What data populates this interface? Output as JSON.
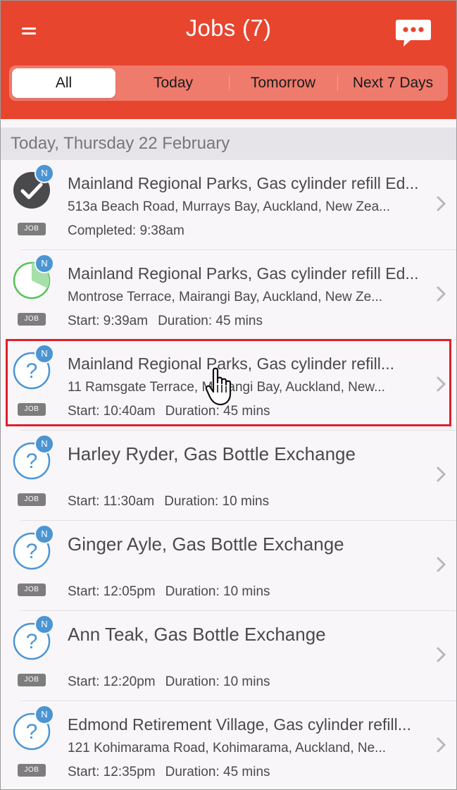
{
  "header": {
    "title": "Jobs (7)",
    "menu_icon": "hamburger-menu-icon",
    "chat_icon": "chat-bubble-icon",
    "background_color": "#e8452f"
  },
  "tabs": [
    {
      "label": "All",
      "active": true
    },
    {
      "label": "Today",
      "active": false
    },
    {
      "label": "Tomorrow",
      "active": false
    },
    {
      "label": "Next 7 Days",
      "active": false
    }
  ],
  "section": {
    "title": "Today, Thursday 22 February"
  },
  "jobs": [
    {
      "title": "Mainland Regional Parks, Gas cylinder refill Ed...",
      "address": "513a Beach Road, Murrays Bay, Auckland, New Zea...",
      "detail": "Completed: 9:38am",
      "duration": "",
      "status": "completed",
      "badge": "N",
      "tag": "JOB"
    },
    {
      "title": "Mainland Regional Parks, Gas cylinder refill Ed...",
      "address": "Montrose Terrace, Mairangi Bay, Auckland, New Ze...",
      "detail": "Start: 9:39am",
      "duration": "Duration: 45 mins",
      "status": "in-progress",
      "badge": "N",
      "tag": "JOB"
    },
    {
      "title": "Mainland Regional Parks, Gas cylinder refill...",
      "address": "11 Ramsgate Terrace, Mairangi Bay, Auckland, New...",
      "detail": "Start: 10:40am",
      "duration": "Duration: 45 mins",
      "status": "unknown",
      "badge": "N",
      "tag": "JOB",
      "highlighted": true
    },
    {
      "title": "Harley Ryder, Gas Bottle Exchange",
      "address": "",
      "detail": "Start: 11:30am",
      "duration": "Duration: 10 mins",
      "status": "unknown",
      "badge": "N",
      "tag": "JOB"
    },
    {
      "title": "Ginger Ayle, Gas Bottle Exchange",
      "address": "",
      "detail": "Start: 12:05pm",
      "duration": "Duration: 10 mins",
      "status": "unknown",
      "badge": "N",
      "tag": "JOB"
    },
    {
      "title": "Ann Teak, Gas Bottle Exchange",
      "address": "",
      "detail": "Start: 12:20pm",
      "duration": "Duration: 10 mins",
      "status": "unknown",
      "badge": "N",
      "tag": "JOB"
    },
    {
      "title": "Edmond Retirement Village, Gas cylinder refill...",
      "address": "121 Kohimarama Road, Kohimarama, Auckland, Ne...",
      "detail": "Start: 12:35pm",
      "duration": "Duration: 45 mins",
      "status": "unknown",
      "badge": "N",
      "tag": "JOB"
    }
  ],
  "icons": {
    "completed": "checkmark-circle-icon",
    "in_progress": "progress-pie-icon",
    "unknown": "question-circle-icon",
    "chevron": "chevron-right-icon",
    "pointer": "hand-pointer-cursor-icon"
  }
}
